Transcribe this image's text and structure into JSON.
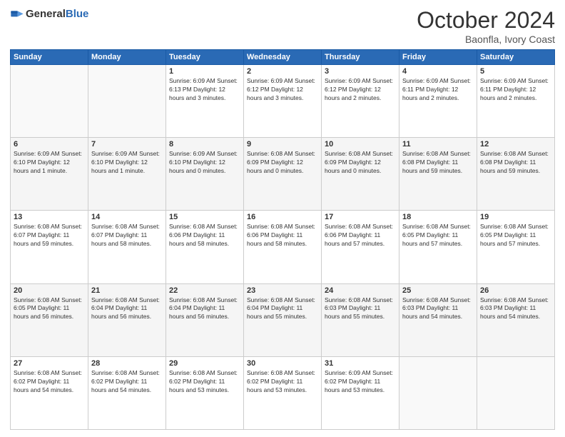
{
  "header": {
    "logo_general": "General",
    "logo_blue": "Blue",
    "month_year": "October 2024",
    "location": "Baonfla, Ivory Coast"
  },
  "days_of_week": [
    "Sunday",
    "Monday",
    "Tuesday",
    "Wednesday",
    "Thursday",
    "Friday",
    "Saturday"
  ],
  "weeks": [
    [
      {
        "day": "",
        "info": ""
      },
      {
        "day": "",
        "info": ""
      },
      {
        "day": "1",
        "info": "Sunrise: 6:09 AM\nSunset: 6:13 PM\nDaylight: 12 hours\nand 3 minutes."
      },
      {
        "day": "2",
        "info": "Sunrise: 6:09 AM\nSunset: 6:12 PM\nDaylight: 12 hours\nand 3 minutes."
      },
      {
        "day": "3",
        "info": "Sunrise: 6:09 AM\nSunset: 6:12 PM\nDaylight: 12 hours\nand 2 minutes."
      },
      {
        "day": "4",
        "info": "Sunrise: 6:09 AM\nSunset: 6:11 PM\nDaylight: 12 hours\nand 2 minutes."
      },
      {
        "day": "5",
        "info": "Sunrise: 6:09 AM\nSunset: 6:11 PM\nDaylight: 12 hours\nand 2 minutes."
      }
    ],
    [
      {
        "day": "6",
        "info": "Sunrise: 6:09 AM\nSunset: 6:10 PM\nDaylight: 12 hours\nand 1 minute."
      },
      {
        "day": "7",
        "info": "Sunrise: 6:09 AM\nSunset: 6:10 PM\nDaylight: 12 hours\nand 1 minute."
      },
      {
        "day": "8",
        "info": "Sunrise: 6:09 AM\nSunset: 6:10 PM\nDaylight: 12 hours\nand 0 minutes."
      },
      {
        "day": "9",
        "info": "Sunrise: 6:08 AM\nSunset: 6:09 PM\nDaylight: 12 hours\nand 0 minutes."
      },
      {
        "day": "10",
        "info": "Sunrise: 6:08 AM\nSunset: 6:09 PM\nDaylight: 12 hours\nand 0 minutes."
      },
      {
        "day": "11",
        "info": "Sunrise: 6:08 AM\nSunset: 6:08 PM\nDaylight: 11 hours\nand 59 minutes."
      },
      {
        "day": "12",
        "info": "Sunrise: 6:08 AM\nSunset: 6:08 PM\nDaylight: 11 hours\nand 59 minutes."
      }
    ],
    [
      {
        "day": "13",
        "info": "Sunrise: 6:08 AM\nSunset: 6:07 PM\nDaylight: 11 hours\nand 59 minutes."
      },
      {
        "day": "14",
        "info": "Sunrise: 6:08 AM\nSunset: 6:07 PM\nDaylight: 11 hours\nand 58 minutes."
      },
      {
        "day": "15",
        "info": "Sunrise: 6:08 AM\nSunset: 6:06 PM\nDaylight: 11 hours\nand 58 minutes."
      },
      {
        "day": "16",
        "info": "Sunrise: 6:08 AM\nSunset: 6:06 PM\nDaylight: 11 hours\nand 58 minutes."
      },
      {
        "day": "17",
        "info": "Sunrise: 6:08 AM\nSunset: 6:06 PM\nDaylight: 11 hours\nand 57 minutes."
      },
      {
        "day": "18",
        "info": "Sunrise: 6:08 AM\nSunset: 6:05 PM\nDaylight: 11 hours\nand 57 minutes."
      },
      {
        "day": "19",
        "info": "Sunrise: 6:08 AM\nSunset: 6:05 PM\nDaylight: 11 hours\nand 57 minutes."
      }
    ],
    [
      {
        "day": "20",
        "info": "Sunrise: 6:08 AM\nSunset: 6:05 PM\nDaylight: 11 hours\nand 56 minutes."
      },
      {
        "day": "21",
        "info": "Sunrise: 6:08 AM\nSunset: 6:04 PM\nDaylight: 11 hours\nand 56 minutes."
      },
      {
        "day": "22",
        "info": "Sunrise: 6:08 AM\nSunset: 6:04 PM\nDaylight: 11 hours\nand 56 minutes."
      },
      {
        "day": "23",
        "info": "Sunrise: 6:08 AM\nSunset: 6:04 PM\nDaylight: 11 hours\nand 55 minutes."
      },
      {
        "day": "24",
        "info": "Sunrise: 6:08 AM\nSunset: 6:03 PM\nDaylight: 11 hours\nand 55 minutes."
      },
      {
        "day": "25",
        "info": "Sunrise: 6:08 AM\nSunset: 6:03 PM\nDaylight: 11 hours\nand 54 minutes."
      },
      {
        "day": "26",
        "info": "Sunrise: 6:08 AM\nSunset: 6:03 PM\nDaylight: 11 hours\nand 54 minutes."
      }
    ],
    [
      {
        "day": "27",
        "info": "Sunrise: 6:08 AM\nSunset: 6:02 PM\nDaylight: 11 hours\nand 54 minutes."
      },
      {
        "day": "28",
        "info": "Sunrise: 6:08 AM\nSunset: 6:02 PM\nDaylight: 11 hours\nand 54 minutes."
      },
      {
        "day": "29",
        "info": "Sunrise: 6:08 AM\nSunset: 6:02 PM\nDaylight: 11 hours\nand 53 minutes."
      },
      {
        "day": "30",
        "info": "Sunrise: 6:08 AM\nSunset: 6:02 PM\nDaylight: 11 hours\nand 53 minutes."
      },
      {
        "day": "31",
        "info": "Sunrise: 6:09 AM\nSunset: 6:02 PM\nDaylight: 11 hours\nand 53 minutes."
      },
      {
        "day": "",
        "info": ""
      },
      {
        "day": "",
        "info": ""
      }
    ]
  ]
}
